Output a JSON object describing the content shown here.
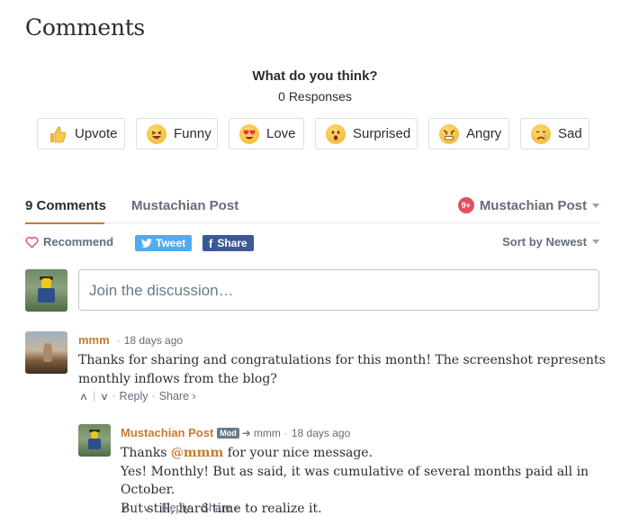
{
  "page": {
    "title": "Comments"
  },
  "reactions_panel": {
    "question": "What do you think?",
    "responses": "0 Responses",
    "reactions": [
      {
        "label": "Upvote",
        "icon": "thumbs-up-icon"
      },
      {
        "label": "Funny",
        "icon": "funny-face-icon"
      },
      {
        "label": "Love",
        "icon": "heart-eyes-icon"
      },
      {
        "label": "Surprised",
        "icon": "surprised-face-icon"
      },
      {
        "label": "Angry",
        "icon": "angry-face-icon"
      },
      {
        "label": "Sad",
        "icon": "sad-face-icon"
      }
    ]
  },
  "tabs": {
    "comments_label": "9 Comments",
    "site_label": "Mustachian Post",
    "user_menu_label": "Mustachian Post",
    "notification_badge": "9+"
  },
  "actions": {
    "recommend": "Recommend",
    "tweet": "Tweet",
    "share": "Share",
    "sort": "Sort by Newest"
  },
  "composer": {
    "placeholder": "Join the discussion…"
  },
  "comments": [
    {
      "author": "mmm",
      "time": "18 days ago",
      "body_lines": [
        "Thanks for sharing and congratulations for this month! The screenshot represents",
        "monthly inflows from the blog?"
      ],
      "reply_label": "Reply",
      "share_label": "Share ›"
    },
    {
      "author": "Mustachian Post",
      "badge": "Mod",
      "in_reply_to": "mmm",
      "time": "18 days ago",
      "body_prefix": "Thanks ",
      "mention": "@mmm",
      "body_suffix": " for your nice message.",
      "body_lines": [
        "Yes! Monthly! But as said, it was cumulative of several months paid all in October.",
        "But still, hard time to realize it."
      ],
      "reply_label": "Reply",
      "share_label": "Share ›"
    }
  ],
  "colors": {
    "accent": "#c77b2e",
    "tweet": "#50abf1",
    "facebook": "#3b5998",
    "badge": "#e44e5f",
    "text": "#2a2e2e",
    "muted": "#656c7a"
  }
}
